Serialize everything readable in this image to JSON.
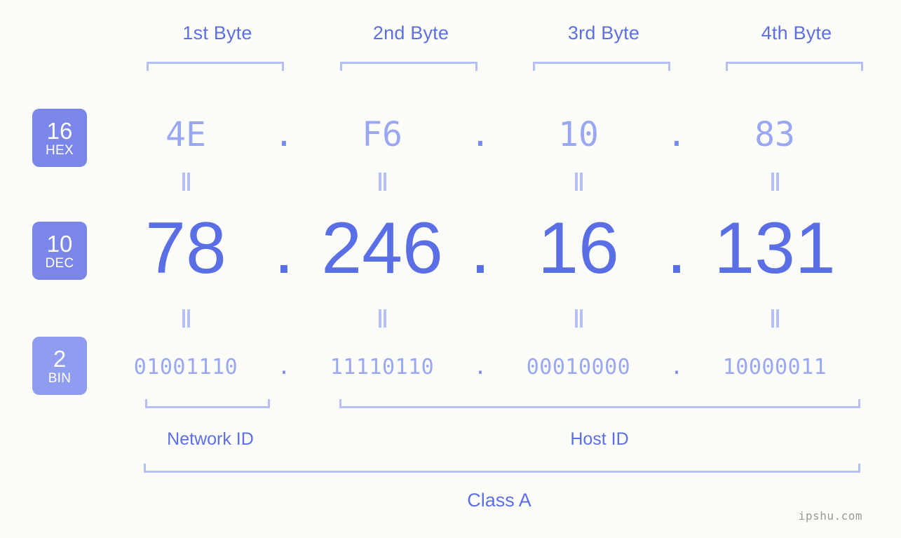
{
  "background_color": "#fcfdf8",
  "accent_color": "#5c6fe8",
  "light_accent_color": "#b6c0f7",
  "value_color": "#9aa7f2",
  "dec_color": "#5a6ee6",
  "byte_headers": [
    {
      "label": "1st Byte"
    },
    {
      "label": "2nd Byte"
    },
    {
      "label": "3rd Byte"
    },
    {
      "label": "4th Byte"
    }
  ],
  "radix_badges": [
    {
      "number": "16",
      "abbr": "HEX",
      "color": "#7b87e8"
    },
    {
      "number": "10",
      "abbr": "DEC",
      "color": "#7b87e8"
    },
    {
      "number": "2",
      "abbr": "BIN",
      "color": "#8f9cf0"
    }
  ],
  "rows": {
    "hex": {
      "values": [
        "4E",
        "F6",
        "10",
        "83"
      ],
      "separator": "."
    },
    "dec": {
      "values": [
        "78",
        "246",
        "16",
        "131"
      ],
      "separator": "."
    },
    "bin": {
      "values": [
        "01001110",
        "11110110",
        "00010000",
        "10000011"
      ],
      "separator": "."
    }
  },
  "segments": {
    "network_id": "Network ID",
    "host_id": "Host ID"
  },
  "class_label": "Class A",
  "watermark": "ipshu.com"
}
